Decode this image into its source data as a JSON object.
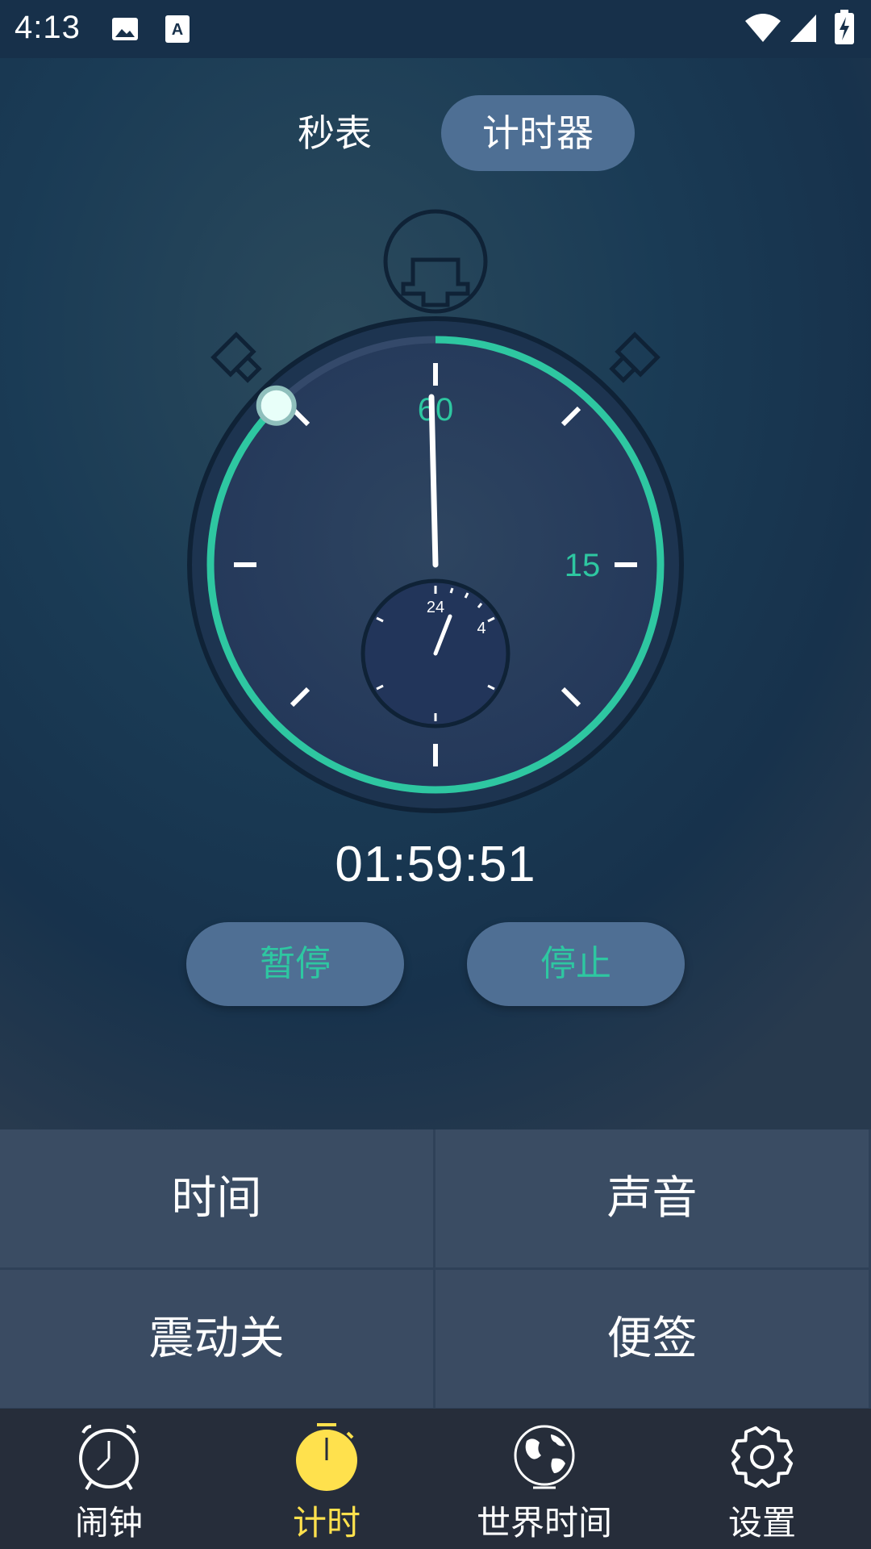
{
  "status_bar": {
    "time": "4:13",
    "icons": [
      "image-icon",
      "text-a-icon",
      "wifi-icon",
      "signal-icon",
      "battery-charging-icon"
    ]
  },
  "mode_tabs": {
    "stopwatch": "秒表",
    "timer": "计时器",
    "selected": "timer"
  },
  "dial": {
    "outer_labels": [
      "60",
      "15"
    ],
    "sub_labels": [
      "24",
      "4"
    ],
    "progress_fraction": 0.875,
    "accent_color": "#2ec7a1"
  },
  "timer": {
    "remaining": "01:59:51"
  },
  "controls": {
    "pause": "暂停",
    "stop": "停止"
  },
  "options": {
    "time": "时间",
    "sound": "声音",
    "vibration": "震动关",
    "note": "便签"
  },
  "bottom_nav": {
    "items": [
      {
        "label": "闹钟",
        "icon": "alarm-clock-icon"
      },
      {
        "label": "计时",
        "icon": "stopwatch-icon"
      },
      {
        "label": "世界时间",
        "icon": "globe-icon"
      },
      {
        "label": "设置",
        "icon": "gear-icon"
      }
    ],
    "active_index": 1,
    "active_color": "#ffe14d"
  }
}
